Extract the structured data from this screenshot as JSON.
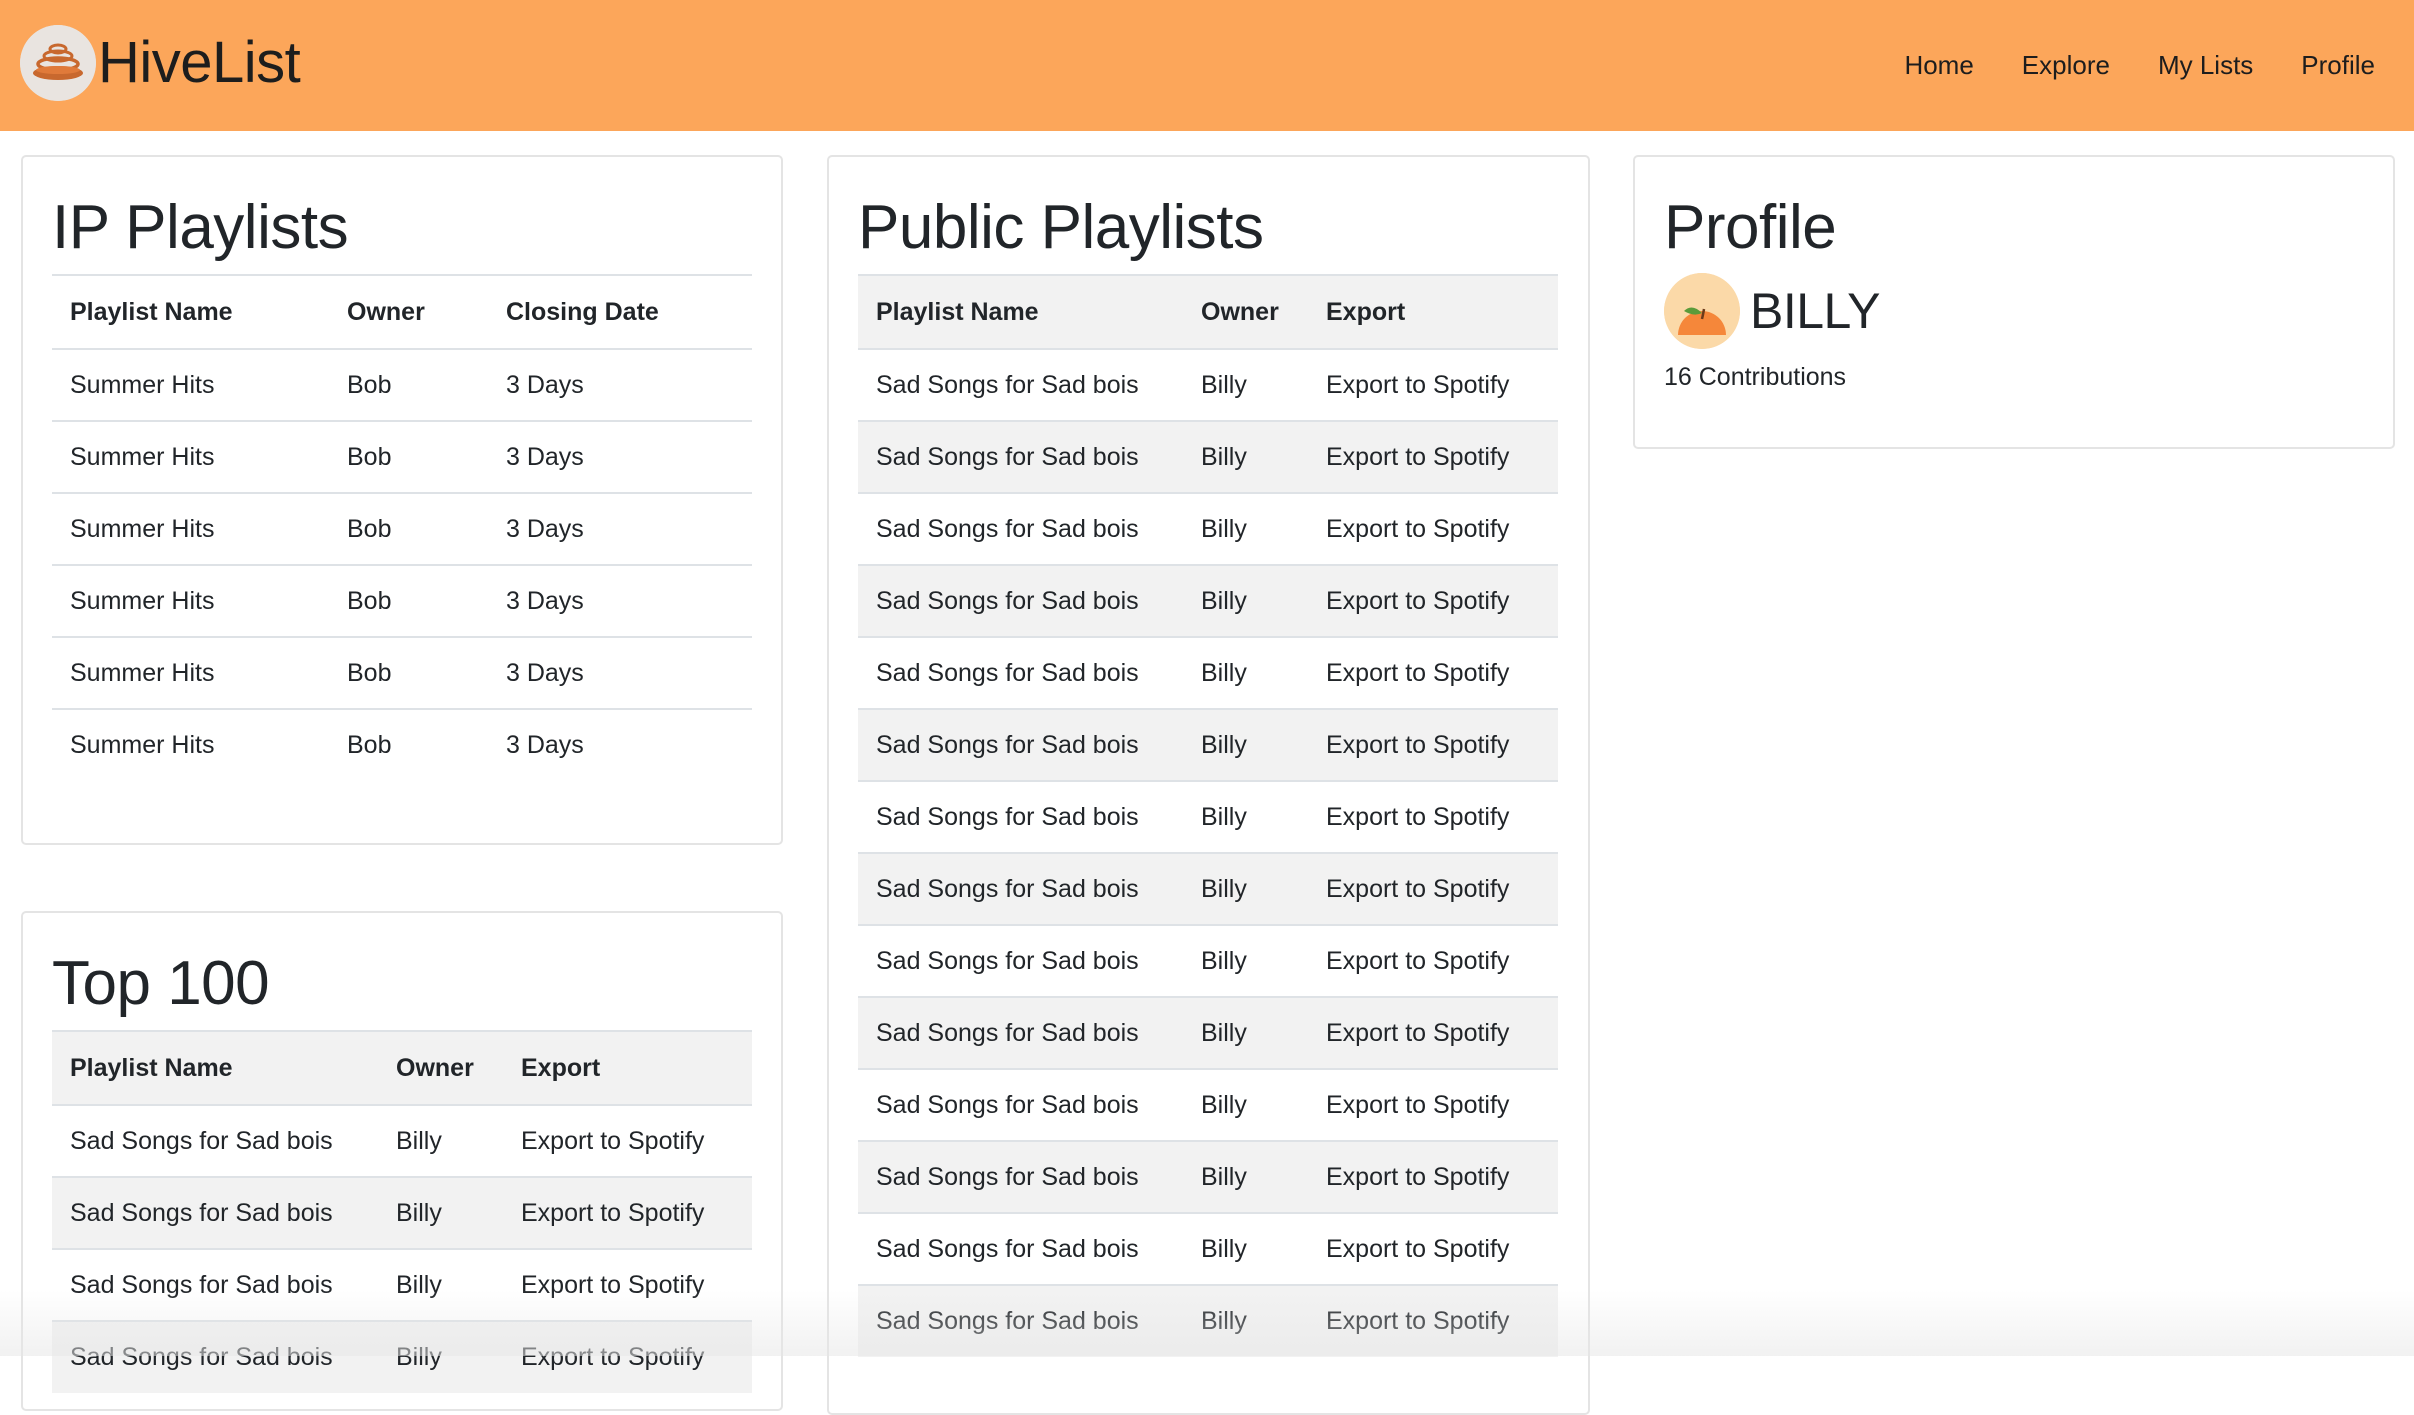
{
  "brand": {
    "name": "HiveList",
    "logo_icon": "hive-logo-icon"
  },
  "nav": {
    "items": [
      "Home",
      "Explore",
      "My Lists",
      "Profile"
    ]
  },
  "colors": {
    "navbar": "#fca65a",
    "stripe": "#f2f2f2",
    "border": "#dee2e6"
  },
  "ip_playlists": {
    "title": "IP Playlists",
    "columns": [
      "Playlist Name",
      "Owner",
      "Closing Date"
    ],
    "rows": [
      [
        "Summer Hits",
        "Bob",
        "3 Days"
      ],
      [
        "Summer Hits",
        "Bob",
        "3 Days"
      ],
      [
        "Summer Hits",
        "Bob",
        "3 Days"
      ],
      [
        "Summer Hits",
        "Bob",
        "3 Days"
      ],
      [
        "Summer Hits",
        "Bob",
        "3 Days"
      ],
      [
        "Summer Hits",
        "Bob",
        "3 Days"
      ]
    ]
  },
  "top_100": {
    "title": "Top 100",
    "columns": [
      "Playlist Name",
      "Owner",
      "Export"
    ],
    "rows": [
      [
        "Sad Songs for Sad bois",
        "Billy",
        "Export to Spotify"
      ],
      [
        "Sad Songs for Sad bois",
        "Billy",
        "Export to Spotify"
      ],
      [
        "Sad Songs for Sad bois",
        "Billy",
        "Export to Spotify"
      ],
      [
        "Sad Songs for Sad bois",
        "Billy",
        "Export to Spotify"
      ]
    ]
  },
  "public_playlists": {
    "title": "Public Playlists",
    "columns": [
      "Playlist Name",
      "Owner",
      "Export"
    ],
    "rows": [
      [
        "Sad Songs for Sad bois",
        "Billy",
        "Export to Spotify"
      ],
      [
        "Sad Songs for Sad bois",
        "Billy",
        "Export to Spotify"
      ],
      [
        "Sad Songs for Sad bois",
        "Billy",
        "Export to Spotify"
      ],
      [
        "Sad Songs for Sad bois",
        "Billy",
        "Export to Spotify"
      ],
      [
        "Sad Songs for Sad bois",
        "Billy",
        "Export to Spotify"
      ],
      [
        "Sad Songs for Sad bois",
        "Billy",
        "Export to Spotify"
      ],
      [
        "Sad Songs for Sad bois",
        "Billy",
        "Export to Spotify"
      ],
      [
        "Sad Songs for Sad bois",
        "Billy",
        "Export to Spotify"
      ],
      [
        "Sad Songs for Sad bois",
        "Billy",
        "Export to Spotify"
      ],
      [
        "Sad Songs for Sad bois",
        "Billy",
        "Export to Spotify"
      ],
      [
        "Sad Songs for Sad bois",
        "Billy",
        "Export to Spotify"
      ],
      [
        "Sad Songs for Sad bois",
        "Billy",
        "Export to Spotify"
      ],
      [
        "Sad Songs for Sad bois",
        "Billy",
        "Export to Spotify"
      ],
      [
        "Sad Songs for Sad bois",
        "Billy",
        "Export to Spotify"
      ]
    ]
  },
  "profile": {
    "title": "Profile",
    "username": "BILLY",
    "contributions": "16 Contributions",
    "avatar_icon": "orange-fruit-avatar-icon"
  }
}
